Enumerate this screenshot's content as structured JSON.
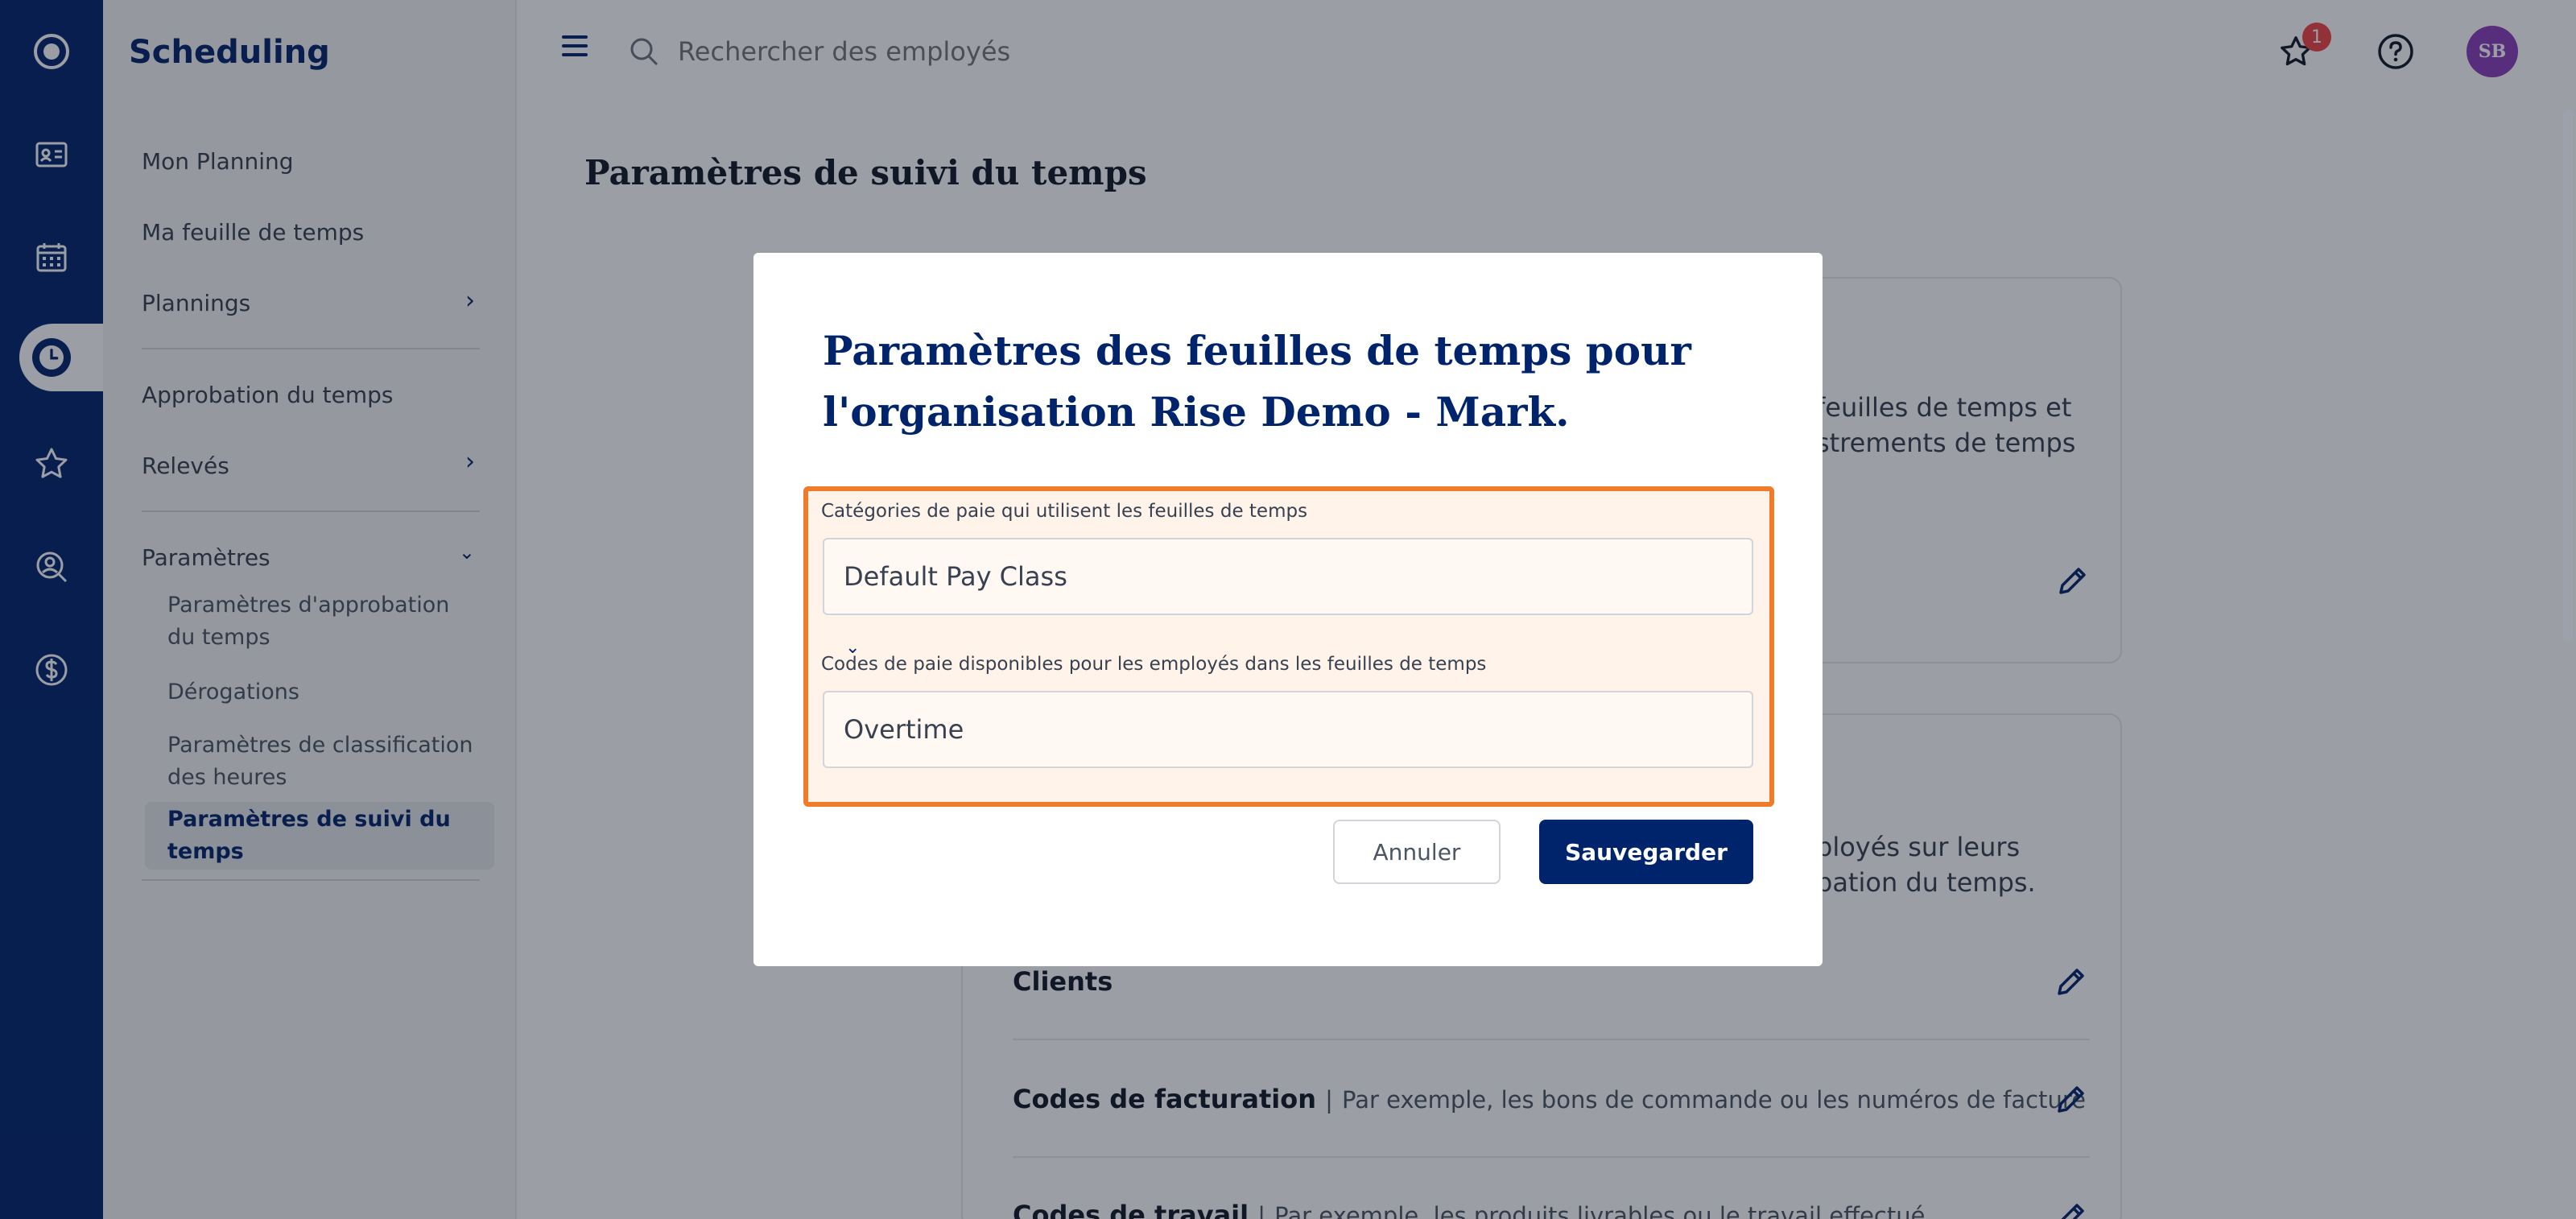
{
  "app": {
    "title": "Scheduling"
  },
  "rail": {
    "icons": [
      "logo-icon",
      "id-card-icon",
      "calendar-icon",
      "clock-icon",
      "star-icon",
      "search-person-icon",
      "dollar-icon"
    ]
  },
  "sidebar": {
    "items": [
      {
        "label": "Mon Planning"
      },
      {
        "label": "Ma feuille de temps"
      },
      {
        "label": "Plannings"
      },
      {
        "label": "Approbation du temps"
      },
      {
        "label": "Relevés"
      },
      {
        "label": "Paramètres"
      }
    ],
    "subitems": [
      {
        "label": "Paramètres d'approbation du temps"
      },
      {
        "label": "Dérogations"
      },
      {
        "label": "Paramètres de classification des heures"
      },
      {
        "label": "Paramètres de suivi du temps"
      }
    ]
  },
  "topbar": {
    "search_placeholder": "Rechercher des employés",
    "favorites_badge": "1",
    "avatar_initials": "SB"
  },
  "main": {
    "page_title": "Paramètres de suivi du temps",
    "card1_text": [
      "feuilles de temps et",
      "strements de temps"
    ],
    "card2_text": [
      "ployés sur leurs",
      "pation du temps."
    ],
    "rows": [
      {
        "label": "Clients",
        "desc": ""
      },
      {
        "label": "Codes de facturation",
        "desc": "Par exemple, les bons de commande ou les numéros de facture"
      },
      {
        "label": "Codes de travail",
        "desc": "Par exemple, les produits livrables ou le travail effectué"
      }
    ]
  },
  "modal": {
    "title": "Paramètres des feuilles de temps pour l'organisation Rise Demo - Mark.",
    "field1_label": "Catégories de paie qui utilisent les feuilles de temps",
    "field1_value": "Default Pay Class",
    "field2_label": "Codes de paie disponibles pour les employés dans les feuilles de temps",
    "field2_value": "Overtime",
    "cancel_label": "Annuler",
    "save_label": "Sauvegarder"
  },
  "colors": {
    "brand": "#00246b",
    "highlight": "#f07c2a",
    "badge": "#ef4444",
    "avatar": "#8b3fb8"
  }
}
